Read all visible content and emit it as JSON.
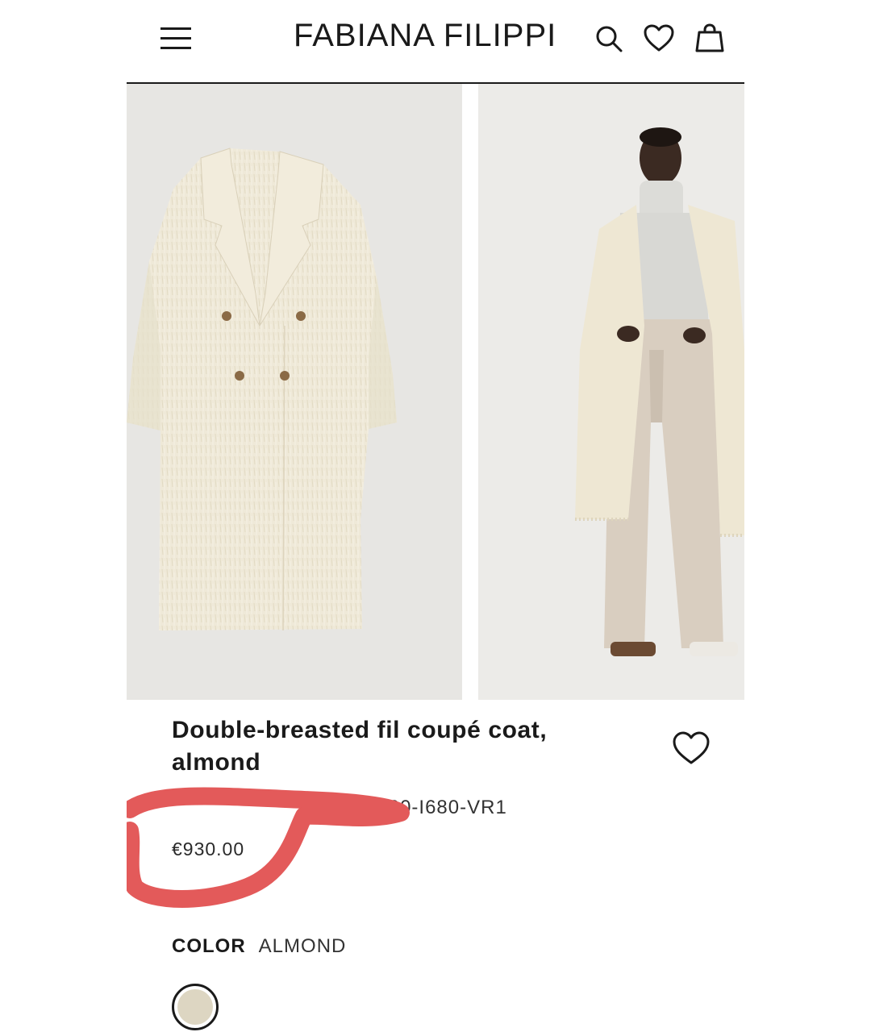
{
  "header": {
    "brand": "FABIANA FILIPPI",
    "icons": [
      "menu-icon",
      "search-icon",
      "heart-icon",
      "shopping-bag-icon"
    ]
  },
  "product": {
    "title": "Double-breasted fil coupé coat, almond",
    "sku_visible": "726-0000-I680-VR1",
    "price": "€930.00",
    "color_label": "COLOR",
    "color_value": "ALMOND"
  },
  "colors": {
    "accent": "#1a1a1a",
    "annotation": "#e35a5a",
    "swatch": "#ddd6c2",
    "coat": "#eee8d6"
  }
}
